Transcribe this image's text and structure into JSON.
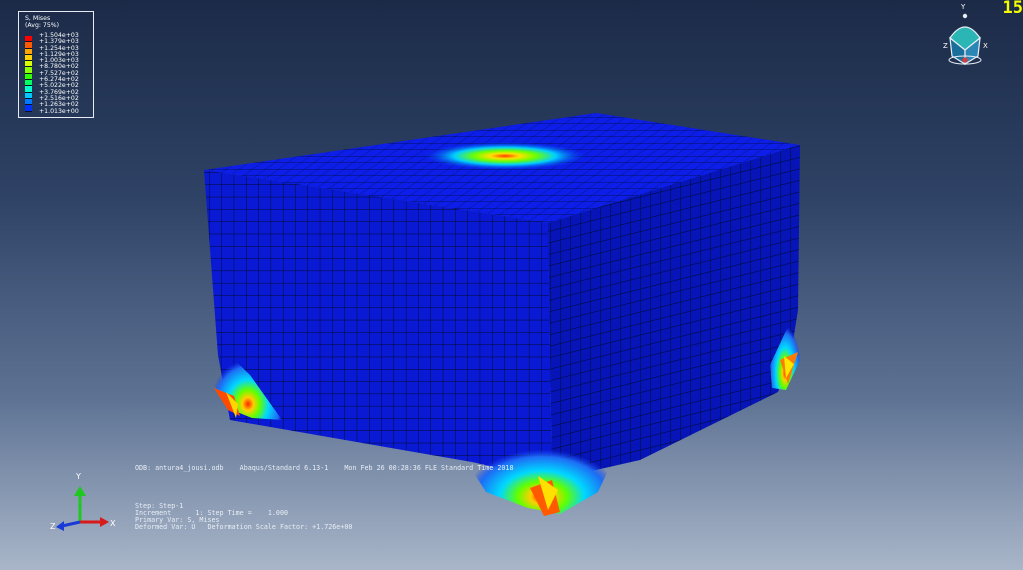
{
  "legend": {
    "title": "S, Mises",
    "subtitle": "(Avg: 75%)",
    "values": [
      "+1.504e+03",
      "+1.379e+03",
      "+1.254e+03",
      "+1.129e+03",
      "+1.003e+03",
      "+8.780e+02",
      "+7.527e+02",
      "+6.274e+02",
      "+5.022e+02",
      "+3.769e+02",
      "+2.516e+02",
      "+1.263e+02",
      "+1.013e+00"
    ],
    "colors": [
      "#ff0000",
      "#ff5a00",
      "#ffa500",
      "#ffd200",
      "#d8ff00",
      "#8cff00",
      "#2dff00",
      "#00ff5f",
      "#00ffc8",
      "#00c8ff",
      "#0078ff",
      "#0032ff",
      "#0000ff"
    ]
  },
  "frame_number": "15",
  "info": {
    "odb_line": "ODB: antura4_jousi.odb    Abaqus/Standard 6.13-1    Mon Feb 26 00:28:36 FLE Standard Time 2018",
    "step_line": "Step: Step-1",
    "increment_line": "Increment      1: Step Time =    1.000",
    "primary_line": "Primary Var: S, Mises",
    "deformed_line": "Deformed Var: U   Deformation Scale Factor: +1.726e+00"
  },
  "triad_bottom": {
    "y": "Y",
    "z": "Z",
    "x": "X"
  },
  "triad_top": {
    "y": "Y",
    "z": "Z",
    "x": "X"
  },
  "colors": {
    "mesh_top": "#0c1ee8",
    "mesh_front": "#0a1ad4",
    "mesh_right": "#0614b8",
    "mesh_lines": "#000820"
  }
}
